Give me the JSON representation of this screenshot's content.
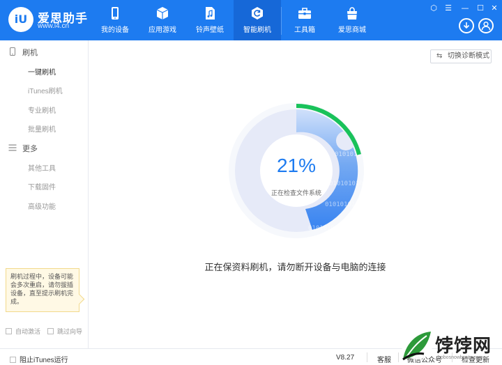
{
  "app": {
    "name": "爱思助手",
    "url": "www.i4.cn",
    "logo_letters": "iU"
  },
  "nav": [
    {
      "label": "我的设备",
      "icon": "phone-icon",
      "active": false
    },
    {
      "label": "应用游戏",
      "icon": "cube-icon",
      "active": false
    },
    {
      "label": "铃声壁纸",
      "icon": "music-file-icon",
      "active": false
    },
    {
      "label": "智能刷机",
      "icon": "flash-refresh-icon",
      "active": true
    },
    {
      "label": "工具箱",
      "icon": "toolbox-icon",
      "active": false
    },
    {
      "label": "爱思商城",
      "icon": "shopping-bag-icon",
      "active": false
    }
  ],
  "window_controls": {
    "skin": "⬡",
    "menu": "☰",
    "minimize": "—",
    "maximize": "☐",
    "close": "✕"
  },
  "sidebar": {
    "groups": [
      {
        "label": "刷机",
        "icon": "phone-outline-icon"
      },
      {
        "label": "更多",
        "icon": "menu-lines-icon"
      }
    ],
    "flash_items": [
      {
        "label": "一键刷机",
        "active": true
      },
      {
        "label": "iTunes刷机",
        "active": false
      },
      {
        "label": "专业刷机",
        "active": false
      },
      {
        "label": "批量刷机",
        "active": false
      }
    ],
    "more_items": [
      {
        "label": "其他工具"
      },
      {
        "label": "下载固件"
      },
      {
        "label": "高级功能"
      }
    ],
    "tip": "刷机过程中，设备可能会多次重启，请勿拔插设备，直至提示刷机完成。",
    "auto_activate": "自动激活",
    "skip_guide": "跳过向导"
  },
  "main": {
    "mode_button": "切换诊断模式",
    "progress": 21,
    "progress_text": "21%",
    "progress_status": "正在检查文件系统",
    "message": "正在保资料刷机，请勿断开设备与电脑的连接",
    "binary_bits": "0101010101",
    "colors": {
      "accent": "#1d7bf0",
      "progress": "#19c25a",
      "ring_light": "#e6eaf8"
    }
  },
  "footer": {
    "block_itunes": "阻止iTunes运行",
    "version": "V8.27",
    "support": "客服",
    "wechat": "微信公众号",
    "check_update": "检查更新"
  },
  "watermark": {
    "text": "饽饽网",
    "sub": "bobosnowboots.com"
  }
}
